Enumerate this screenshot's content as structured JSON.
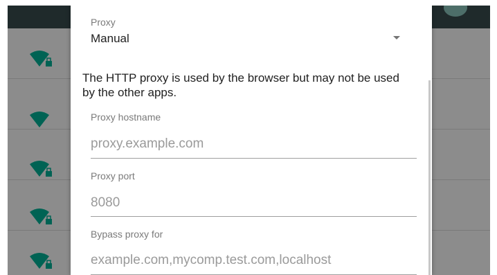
{
  "background": {
    "wifi_rows": [
      {
        "icon": "wifi-locked-icon"
      },
      {
        "icon": "wifi-icon"
      },
      {
        "icon": "wifi-locked-icon"
      },
      {
        "icon": "wifi-locked-icon"
      },
      {
        "icon": "wifi-locked-icon"
      }
    ]
  },
  "dialog": {
    "proxy": {
      "label": "Proxy",
      "selected": "Manual"
    },
    "info_text": "The HTTP proxy is used by the browser but may not be used by the other apps.",
    "hostname": {
      "label": "Proxy hostname",
      "placeholder": "proxy.example.com",
      "value": ""
    },
    "port": {
      "label": "Proxy port",
      "placeholder": "8080",
      "value": ""
    },
    "bypass": {
      "label": "Bypass proxy for",
      "placeholder": "example.com,mycomp.test.com,localhost",
      "value": ""
    }
  },
  "colors": {
    "wifi_icon": "#006354",
    "status_bar": "#1f2a2b",
    "scrim": "#8c8c8c"
  }
}
